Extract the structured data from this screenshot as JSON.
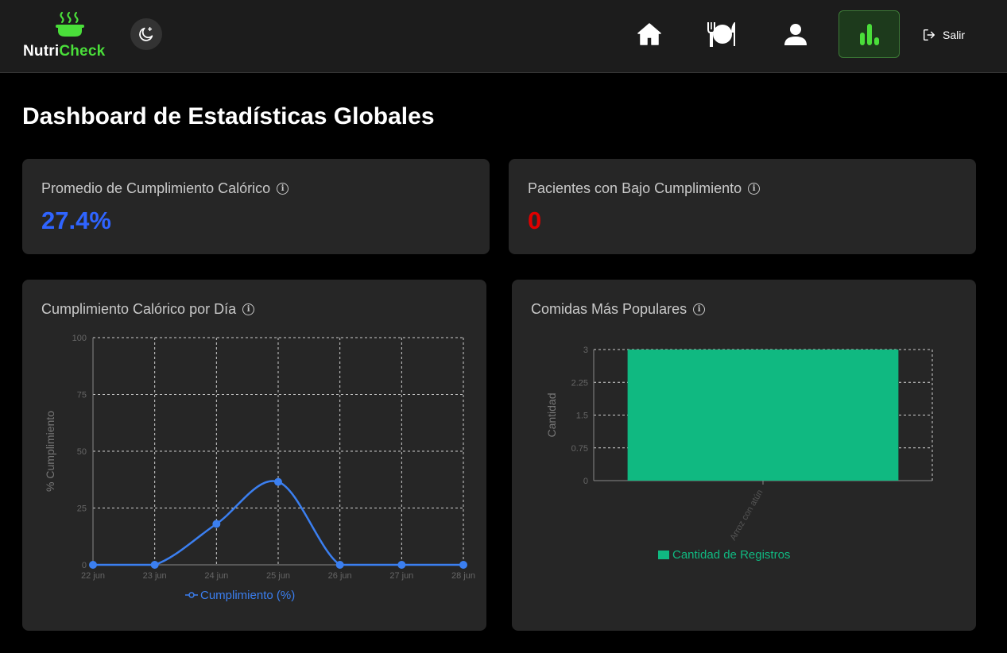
{
  "brand": {
    "name_part1": "Nutri",
    "name_part2": "Check"
  },
  "nav": {
    "logout_label": "Salir"
  },
  "page": {
    "title": "Dashboard de Estadísticas Globales"
  },
  "stats": {
    "avg_compliance": {
      "label": "Promedio de Cumplimiento Calórico",
      "value": "27.4%",
      "color": "#2f64ff"
    },
    "low_compliance": {
      "label": "Pacientes con Bajo Cumplimiento",
      "value": "0",
      "color": "#e00000"
    }
  },
  "colors": {
    "accent_green": "#4ade3a",
    "line_blue": "#3b7ff0",
    "bar_green": "#10b981"
  },
  "charts": {
    "line": {
      "title": "Cumplimiento Calórico por Día"
    },
    "bar": {
      "title": "Comidas Más Populares"
    }
  },
  "chart_data": [
    {
      "type": "line",
      "title": "Cumplimiento Calórico por Día",
      "ylabel": "% Cumplimiento",
      "categories": [
        "22 jun",
        "23 jun",
        "24 jun",
        "25 jun",
        "26 jun",
        "27 jun",
        "28 jun"
      ],
      "series": [
        {
          "name": "Cumplimiento (%)",
          "values": [
            0,
            0,
            18,
            36.5,
            0,
            0,
            0
          ]
        }
      ],
      "ylim": [
        0,
        100
      ],
      "yticks": [
        0,
        25,
        50,
        75,
        100
      ],
      "grid": true,
      "legend": "bottom"
    },
    {
      "type": "bar",
      "title": "Comidas Más Populares",
      "ylabel": "Cantidad",
      "categories": [
        "Arroz con atún"
      ],
      "series": [
        {
          "name": "Cantidad de Registros",
          "values": [
            3
          ]
        }
      ],
      "ylim": [
        0,
        3
      ],
      "yticks": [
        0,
        0.75,
        1.5,
        2.25,
        3
      ],
      "grid": true,
      "legend": "bottom"
    }
  ]
}
